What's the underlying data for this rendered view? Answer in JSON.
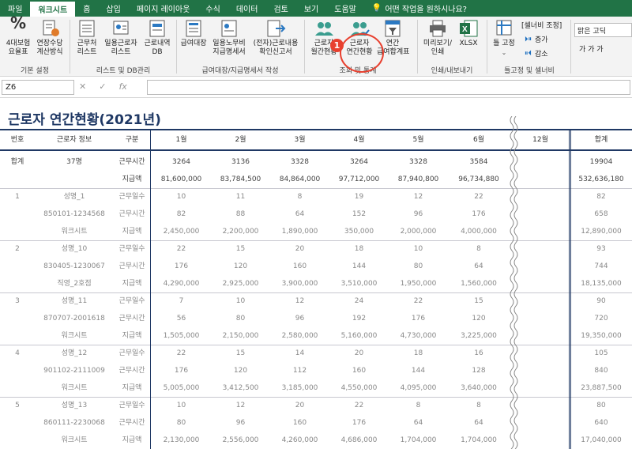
{
  "tabs": [
    "파일",
    "워크시트",
    "홈",
    "삽입",
    "페이지 레이아웃",
    "수식",
    "데이터",
    "검토",
    "보기",
    "도움말"
  ],
  "tell_me": "어떤 작업을 원하시나요?",
  "ribbon": {
    "btn_4ins": "4대보험\n요율표",
    "btn_ext": "연장수당\n계산방식",
    "grp_basic": "기본 설정",
    "btn_worker_list": "근무처\n리스트",
    "btn_daily_list": "일용근로자\n리스트",
    "btn_work_db": "근로내역\nDB",
    "grp_list": "리스트 및 DB관리",
    "btn_pay_ledger": "급여대장",
    "btn_daily_pay": "일용노무비\n지급명세서",
    "btn_e_report": "(전자)근로내용\n확인신고서",
    "grp_pay": "급여대장/지급명세서 작성",
    "btn_monthly": "근로자\n월간현황",
    "btn_annual": "근로자\n연간현황",
    "btn_annual_pay": "연간\n급여합계표",
    "grp_query": "조회 및 통계",
    "btn_preview": "미리보기/\n인쇄",
    "btn_xlsx": "XLSX",
    "grp_print": "인쇄/내보내기",
    "btn_freeze": "틀 고정",
    "lbl_col_adjust": "[셀너비 조정]",
    "btn_inc": "증가",
    "btn_dec": "감소",
    "grp_freeze": "틀고정 및 셀너비",
    "font_name": "맑은 고딕",
    "font_btns": "가  가  가"
  },
  "callout": "1",
  "namebox": "Z6",
  "title": "근로자 연간현황(2021년)",
  "headers": {
    "no": "번호",
    "info": "근로자 정보",
    "type": "구분",
    "m1": "1월",
    "m2": "2월",
    "m3": "3월",
    "m4": "4월",
    "m5": "5월",
    "m6": "6월",
    "m12": "12월",
    "total": "합계"
  },
  "rows": [
    {
      "no": "합계",
      "info": "37명",
      "type": "근무시간",
      "v": [
        "3264",
        "3136",
        "3328",
        "3264",
        "3328",
        "3584"
      ],
      "total": "19904",
      "dark": true
    },
    {
      "no": "",
      "info": "",
      "type": "지급액",
      "v": [
        "81,600,000",
        "83,784,500",
        "84,864,000",
        "97,712,000",
        "87,940,800",
        "96,734,880"
      ],
      "total": "532,636,180",
      "dark": true
    },
    {
      "no": "1",
      "info": "성명_1",
      "type": "근무일수",
      "v": [
        "10",
        "11",
        "8",
        "19",
        "12",
        "22"
      ],
      "total": "82"
    },
    {
      "no": "",
      "info": "850101-1234568",
      "type": "근무시간",
      "v": [
        "82",
        "88",
        "64",
        "152",
        "96",
        "176"
      ],
      "total": "658"
    },
    {
      "no": "",
      "info": "워크시트",
      "type": "지급액",
      "v": [
        "2,450,000",
        "2,200,000",
        "1,890,000",
        "350,000",
        "2,000,000",
        "4,000,000"
      ],
      "total": "12,890,000"
    },
    {
      "no": "2",
      "info": "성명_10",
      "type": "근무일수",
      "v": [
        "22",
        "15",
        "20",
        "18",
        "10",
        "8"
      ],
      "total": "93"
    },
    {
      "no": "",
      "info": "830405-1230067",
      "type": "근무시간",
      "v": [
        "176",
        "120",
        "160",
        "144",
        "80",
        "64"
      ],
      "total": "744"
    },
    {
      "no": "",
      "info": "직영_2호점",
      "type": "지급액",
      "v": [
        "4,290,000",
        "2,925,000",
        "3,900,000",
        "3,510,000",
        "1,950,000",
        "1,560,000"
      ],
      "total": "18,135,000"
    },
    {
      "no": "3",
      "info": "성명_11",
      "type": "근무일수",
      "v": [
        "7",
        "10",
        "12",
        "24",
        "22",
        "15"
      ],
      "total": "90"
    },
    {
      "no": "",
      "info": "870707-2001618",
      "type": "근무시간",
      "v": [
        "56",
        "80",
        "96",
        "192",
        "176",
        "120"
      ],
      "total": "720"
    },
    {
      "no": "",
      "info": "워크시트",
      "type": "지급액",
      "v": [
        "1,505,000",
        "2,150,000",
        "2,580,000",
        "5,160,000",
        "4,730,000",
        "3,225,000"
      ],
      "total": "19,350,000"
    },
    {
      "no": "4",
      "info": "성명_12",
      "type": "근무일수",
      "v": [
        "22",
        "15",
        "14",
        "20",
        "18",
        "16"
      ],
      "total": "105"
    },
    {
      "no": "",
      "info": "901102-2111009",
      "type": "근무시간",
      "v": [
        "176",
        "120",
        "112",
        "160",
        "144",
        "128"
      ],
      "total": "840"
    },
    {
      "no": "",
      "info": "워크시트",
      "type": "지급액",
      "v": [
        "5,005,000",
        "3,412,500",
        "3,185,000",
        "4,550,000",
        "4,095,000",
        "3,640,000"
      ],
      "total": "23,887,500"
    },
    {
      "no": "5",
      "info": "성명_13",
      "type": "근무일수",
      "v": [
        "10",
        "12",
        "20",
        "22",
        "8",
        "8"
      ],
      "total": "80"
    },
    {
      "no": "",
      "info": "860111-2230068",
      "type": "근무시간",
      "v": [
        "80",
        "96",
        "160",
        "176",
        "64",
        "64"
      ],
      "total": "640"
    },
    {
      "no": "",
      "info": "워크시트",
      "type": "지급액",
      "v": [
        "2,130,000",
        "2,556,000",
        "4,260,000",
        "4,686,000",
        "1,704,000",
        "1,704,000"
      ],
      "total": "17,040,000"
    }
  ],
  "colors": {
    "ribbon_green": "#217346",
    "header_navy": "#1f3864",
    "callout_red": "#e8402f"
  }
}
